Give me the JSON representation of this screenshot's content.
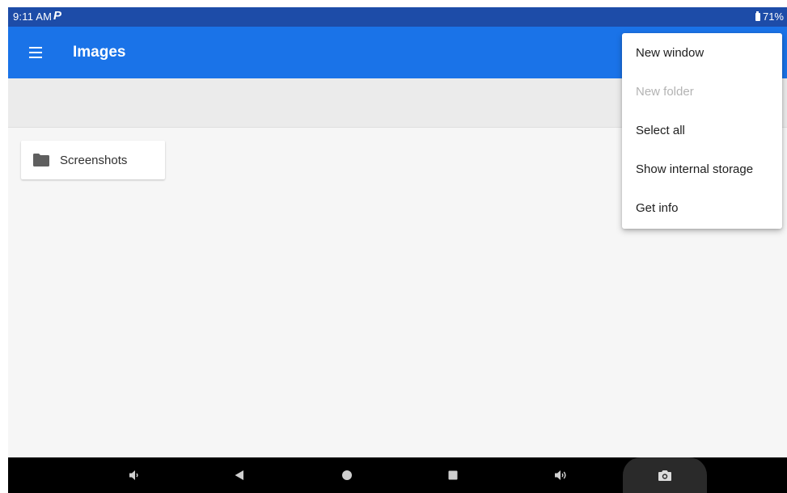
{
  "status_bar": {
    "time": "9:11 AM",
    "notification_letter": "P",
    "battery_percent": "71%"
  },
  "app_bar": {
    "title": "Images",
    "menu_icon": "hamburger-menu-icon"
  },
  "content": {
    "folders": [
      {
        "name": "Screenshots",
        "icon": "folder-icon"
      }
    ]
  },
  "overflow_menu": {
    "items": [
      {
        "label": "New window",
        "enabled": true
      },
      {
        "label": "New folder",
        "enabled": false
      },
      {
        "label": "Select all",
        "enabled": true
      },
      {
        "label": "Show internal storage",
        "enabled": true
      },
      {
        "label": "Get info",
        "enabled": true
      }
    ]
  },
  "nav_bar": {
    "buttons": [
      "volume-down-icon",
      "back-icon",
      "home-icon",
      "recents-icon",
      "volume-up-icon",
      "screenshot-camera-icon"
    ]
  },
  "colors": {
    "status_bar": "#1d4ca8",
    "app_bar": "#1a73e8",
    "background": "#f6f6f6",
    "nav_bar": "#000000"
  }
}
